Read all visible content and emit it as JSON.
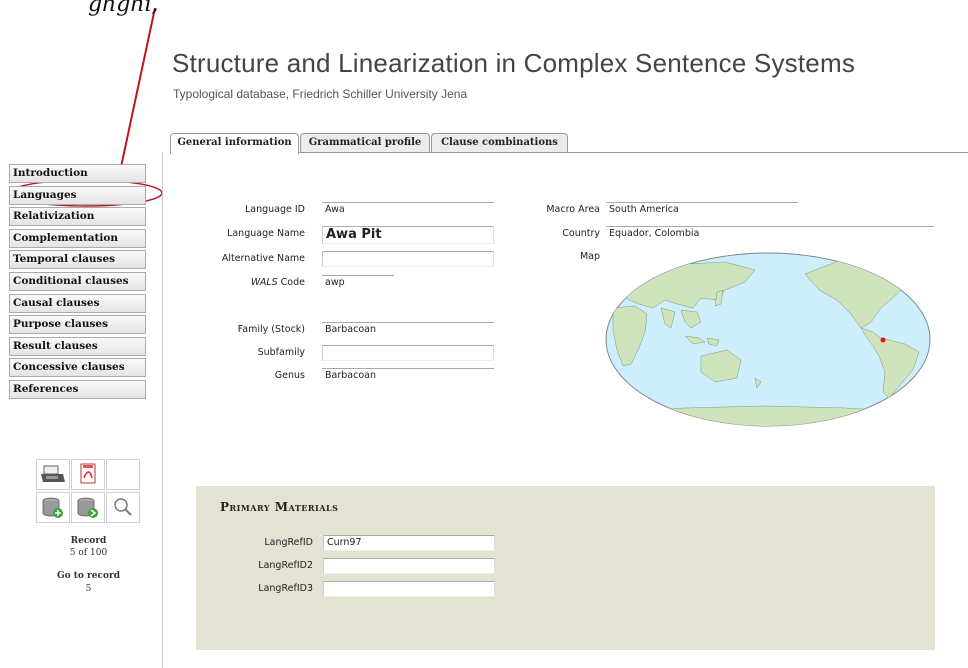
{
  "annotation": {
    "fragment_text": "",
    "circle_color": "#c0141c"
  },
  "header": {
    "title": "Structure and Linearization in Complex Sentence Systems",
    "subtitle": "Typological database, Friedrich Schiller University Jena"
  },
  "tabs": [
    {
      "label": "General information",
      "active": true
    },
    {
      "label": "Grammatical profile",
      "active": false
    },
    {
      "label": "Clause combinations",
      "active": false
    }
  ],
  "nav": {
    "items": [
      {
        "label": "Introduction"
      },
      {
        "label": "Languages",
        "selected": true
      },
      {
        "label": "Relativization"
      },
      {
        "label": "Complementation"
      },
      {
        "label": "Temporal clauses"
      },
      {
        "label": "Conditional clauses"
      },
      {
        "label": "Causal clauses"
      },
      {
        "label": "Purpose clauses"
      },
      {
        "label": "Result clauses"
      },
      {
        "label": "Concessive clauses"
      },
      {
        "label": "References"
      }
    ]
  },
  "form": {
    "language_id": {
      "label": "Language ID",
      "value": "Awa"
    },
    "language_name": {
      "label": "Language Name",
      "value": "Awa Pit"
    },
    "alternative_name": {
      "label": "Alternative Name",
      "value": ""
    },
    "wals_code": {
      "label_em": "WALS",
      "label_rest": " Code",
      "value": "awp"
    },
    "family": {
      "label": "Family (Stock)",
      "value": "Barbacoan"
    },
    "subfamily": {
      "label": "Subfamily",
      "value": ""
    },
    "genus": {
      "label": "Genus",
      "value": "Barbacoan"
    },
    "macro_area": {
      "label": "Macro Area",
      "value": "South America"
    },
    "country": {
      "label": "Country",
      "value": "Equador, Colombia"
    },
    "map": {
      "label": "Map",
      "ocean_color": "#cdeefa",
      "land_color": "#cfe3bd",
      "marker_color": "#e8141a"
    }
  },
  "toolbox": {
    "icons": [
      "printer-icon",
      "pdf-icon",
      "database-add-icon",
      "database-next-icon",
      "search-icon"
    ]
  },
  "record": {
    "record_label": "Record",
    "record_value": "5 of 100",
    "goto_label": "Go to record",
    "goto_value": "5"
  },
  "materials": {
    "title": "Primary Materials",
    "fields": [
      {
        "label": "LangRefID",
        "value": "Curn97"
      },
      {
        "label": "LangRefID2",
        "value": ""
      },
      {
        "label": "LangRefID3",
        "value": ""
      }
    ]
  }
}
